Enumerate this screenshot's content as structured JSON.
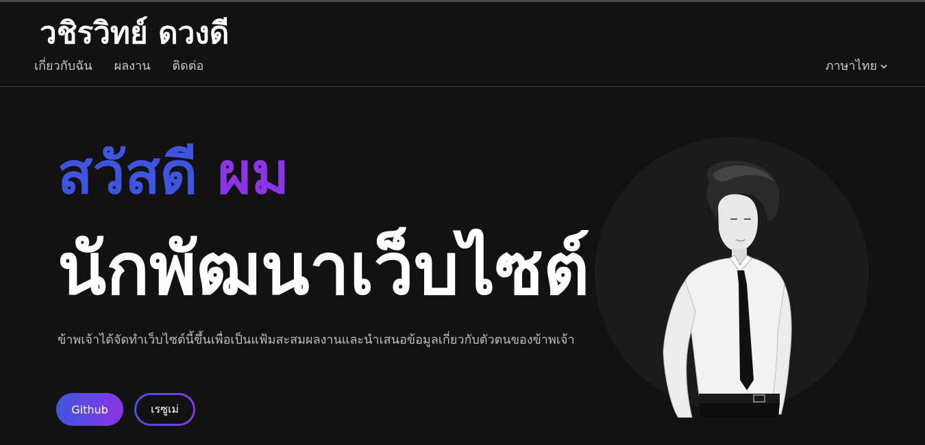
{
  "header": {
    "brand": "วชิรวิทย์ ดวงดี",
    "nav": [
      {
        "label": "เกี่ยวกับฉัน"
      },
      {
        "label": "ผลงาน"
      },
      {
        "label": "ติดต่อ"
      }
    ],
    "language": {
      "label": "ภาษาไทย",
      "icon": "chevron-down-icon"
    }
  },
  "hero": {
    "greeting_1": "สวัสดี",
    "greeting_2": "ผม",
    "title": "นักพัฒนาเว็บไซต์",
    "description": "ข้าพเจ้าได้จัดทำเว็บไซต์นี้ขึ้นเพื่อเป็นแฟ้มสะสมผลงานและนำเสนอข้อมูลเกี่ยวกับตัวตนของข้าพเจ้า",
    "buttons": {
      "github": "Github",
      "resume": "เรซูเม่"
    },
    "portrait": {
      "alt_icon": "portrait-illustration"
    }
  },
  "colors": {
    "background": "#121212",
    "accent_blue": "#3f55e0",
    "accent_purple": "#8a35e6",
    "muted_text": "#bdbdbd"
  }
}
